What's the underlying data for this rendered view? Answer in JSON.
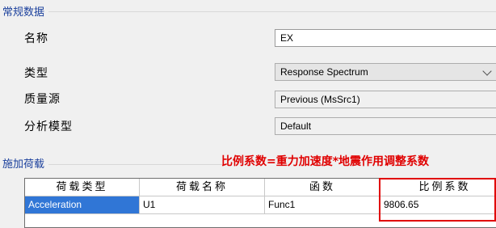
{
  "general": {
    "title": "常规数据",
    "fields": [
      {
        "label": "名称",
        "value": "EX"
      },
      {
        "label": "类型",
        "value": "Response Spectrum"
      },
      {
        "label": "质量源",
        "value": "Previous (MsSrc1)"
      },
      {
        "label": "分析模型",
        "value": "Default"
      }
    ]
  },
  "loads": {
    "title": "施加荷载",
    "note": "比例系数=重力加速度*地震作用调整系数",
    "note_color": "#e00000",
    "columns": [
      "荷载类型",
      "荷载名称",
      "函数",
      "比例系数"
    ],
    "rows": [
      [
        "Acceleration",
        "U1",
        "Func1",
        "9806.65"
      ]
    ]
  },
  "icons": {
    "type_dropdown": "chevron-down-icon"
  },
  "colors": {
    "selection": "#3076d6",
    "group_title": "#1a3f9c"
  }
}
